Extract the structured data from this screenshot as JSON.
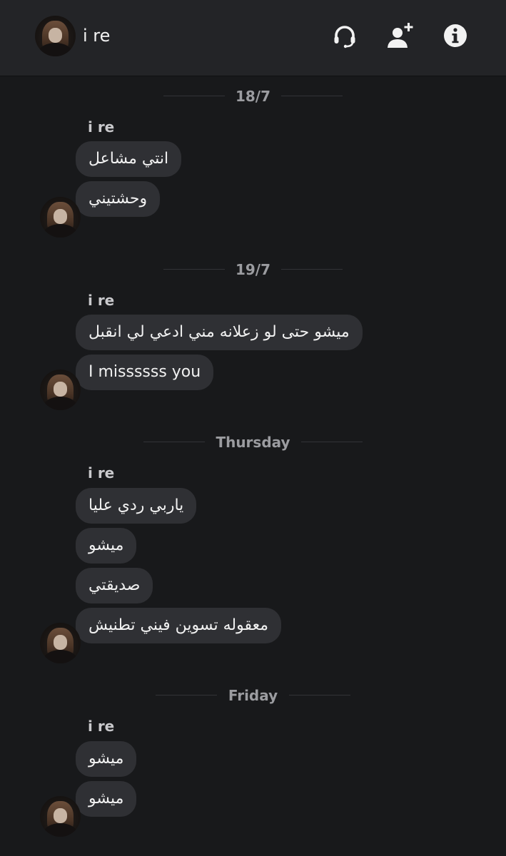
{
  "header": {
    "title": "i re",
    "icons": [
      "headset-icon",
      "add-user-icon",
      "info-icon"
    ]
  },
  "colors": {
    "background": "#18191b",
    "header": "#232427",
    "bubble": "#2f3034",
    "date_label": "#9b9ca0"
  },
  "groups": [
    {
      "date": "18/7",
      "sender": "i re",
      "messages": [
        "انتي مشاعل",
        "وحشتيني"
      ]
    },
    {
      "date": "19/7",
      "sender": "i re",
      "messages": [
        "ميشو حتى لو زعلانه مني ادعي لي انقبل",
        "I missssss you"
      ]
    },
    {
      "date": "Thursday",
      "sender": "i re",
      "messages": [
        "ياربي ردي عليا",
        "ميشو",
        "صديقتي",
        "معقوله تسوين فيني تطنيش"
      ]
    },
    {
      "date": "Friday",
      "sender": "i re",
      "messages": [
        "ميشو",
        "ميشو"
      ]
    }
  ]
}
